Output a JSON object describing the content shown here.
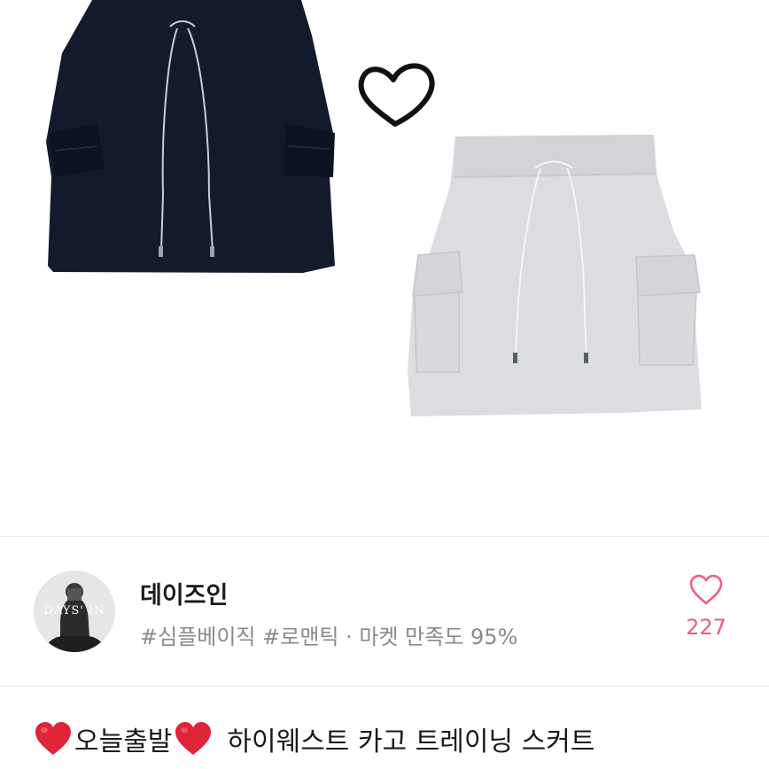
{
  "product": {
    "image_icon": "skirt-photo",
    "heart_doodle_icon": "heart-outline-icon"
  },
  "seller": {
    "avatar_text": "DAYS' IN",
    "name": "데이즈인",
    "tags_and_rating": "#심플베이직 #로맨틱 · 마켓 만족도 95%"
  },
  "like": {
    "icon": "heart-outline-icon",
    "count": "227"
  },
  "title": {
    "emoji_icon": "red-heart-icon",
    "part_1": "오늘출발",
    "part_2": "하이웨스트 카고 트레이닝 스커트"
  },
  "colors": {
    "accent_pink": "#ee5c7c",
    "heart_red": "#e0243a",
    "skirt_navy": "#121a2b",
    "skirt_gray": "#dcdde0"
  }
}
